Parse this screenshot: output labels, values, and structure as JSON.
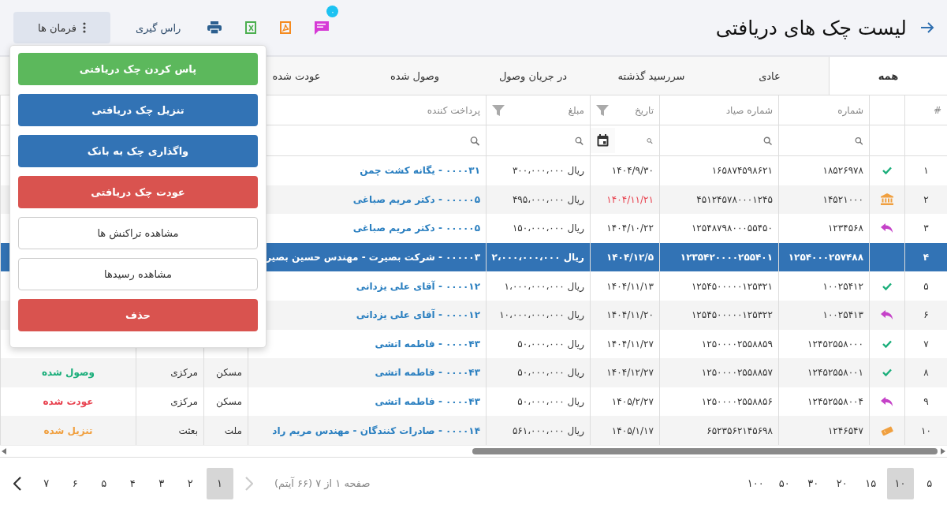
{
  "header": {
    "title": "لیست چک های دریافتی",
    "notification_badge": "۰",
    "report_button": "راس گیری",
    "commands_button": "فرمان ها"
  },
  "commands_menu": {
    "expanded": true,
    "items": [
      {
        "label": "پاس کردن چک دریافتی",
        "kind": "success"
      },
      {
        "label": "تنزیل چک دریافتی",
        "kind": "primary"
      },
      {
        "label": "واگذاری چک به بانک",
        "kind": "primary"
      },
      {
        "label": "عودت چک دریافتی",
        "kind": "danger"
      },
      {
        "label": "مشاهده تراکنش ها",
        "kind": "default"
      },
      {
        "label": "مشاهده رسیدها",
        "kind": "default"
      },
      {
        "label": "حذف",
        "kind": "danger"
      }
    ]
  },
  "tabs": [
    {
      "label": "همه",
      "selected": true
    },
    {
      "label": "عادی",
      "selected": false
    },
    {
      "label": "سررسید گذشته",
      "selected": false
    },
    {
      "label": "در جریان وصول",
      "selected": false
    },
    {
      "label": "وصول شده",
      "selected": false
    },
    {
      "label": "عودت شده",
      "selected": false
    }
  ],
  "table": {
    "columns": [
      {
        "label": "#"
      },
      {
        "label": "شماره",
        "search": true
      },
      {
        "label": "شماره صیاد",
        "search": true
      },
      {
        "label": "تاریخ",
        "search": true,
        "filter": true,
        "calendar": true
      },
      {
        "label": "مبلغ",
        "search": true,
        "filter": true
      },
      {
        "label": "پرداخت کننده",
        "search": true
      }
    ],
    "rows": [
      {
        "index": "۱",
        "kind": "check",
        "number": "۱۸۵۲۶۹۷۸",
        "sayad": "۱۶۵۸۷۴۵۹۸۶۲۱",
        "date": "۱۴۰۴/۹/۳۰",
        "overdue": false,
        "amount": "ریال ۳۰۰،۰۰۰،۰۰۰",
        "payer": "۰۰۰۰۳۱ - یگانه کشت چمن",
        "selected": false
      },
      {
        "index": "۲",
        "kind": "bank",
        "number": "۱۴۵۲۱۰۰۰",
        "sayad": "۴۵۱۲۴۵۷۸۰۰۰۱۲۴۵",
        "date": "۱۴۰۴/۱۱/۲۱",
        "overdue": true,
        "amount": "ریال ۴۹۵،۰۰۰،۰۰۰",
        "payer": "۰۰۰۰۰۵ - دکتر مریم صباغی",
        "selected": false
      },
      {
        "index": "۳",
        "kind": "reply",
        "number": "۱۲۳۴۵۶۸",
        "sayad": "۱۲۵۴۸۷۹۸۰۰۰۵۵۴۵۰",
        "date": "۱۴۰۴/۱۰/۲۲",
        "overdue": false,
        "amount": "ریال ۱۵۰،۰۰۰،۰۰۰",
        "payer": "۰۰۰۰۰۵ - دکتر مریم صباغی",
        "selected": false
      },
      {
        "index": "۴",
        "number": "۱۲۵۴۰۰۰۲۵۷۴۸۸",
        "sayad": "۱۲۳۵۴۲۰۰۰۰۲۵۵۴۰۱",
        "date": "۱۴۰۴/۱۲/۵",
        "overdue": false,
        "amount": "ریال ۲،۰۰۰،۰۰۰،۰۰۰",
        "payer": "۰۰۰۰۰۳ - شرکت بصیرت - مهندس حسین بصیر",
        "selected": true
      },
      {
        "index": "۵",
        "kind": "check",
        "number": "۱۰۰۲۵۴۱۲",
        "sayad": "۱۲۵۴۵۰۰۰۰۰۱۲۵۳۲۱",
        "date": "۱۴۰۴/۱۱/۱۳",
        "overdue": false,
        "amount": "ریال ۱،۰۰۰،۰۰۰،۰۰۰",
        "payer": "۰۰۰۰۱۲ - آقای علی یزدانی",
        "selected": false
      },
      {
        "index": "۶",
        "kind": "reply",
        "number": "۱۰۰۲۵۴۱۳",
        "sayad": "۱۲۵۴۵۰۰۰۰۰۱۲۵۳۲۲",
        "date": "۱۴۰۴/۱۱/۲۰",
        "overdue": false,
        "amount": "ریال ۱۰،۰۰۰،۰۰۰،۰۰۰",
        "payer": "۰۰۰۰۱۲ - آقای علی یزدانی",
        "selected": false
      },
      {
        "index": "۷",
        "kind": "check",
        "number": "۱۲۴۵۲۵۵۸۰۰۰",
        "sayad": "۱۲۵۰۰۰۰۲۵۵۸۸۵۹",
        "date": "۱۴۰۴/۱۱/۲۷",
        "overdue": false,
        "amount": "ریال ۵۰،۰۰۰،۰۰۰",
        "payer": "۰۰۰۰۴۳ - فاطمه اتشی",
        "selected": false
      },
      {
        "index": "۸",
        "kind": "check",
        "number": "۱۲۴۵۲۵۵۸۰۰۱",
        "sayad": "۱۲۵۰۰۰۰۲۵۵۸۸۵۷",
        "date": "۱۴۰۴/۱۲/۲۷",
        "overdue": false,
        "amount": "ریال ۵۰،۰۰۰،۰۰۰",
        "payer": "۰۰۰۰۴۳ - فاطمه اتشی",
        "bank": "مسکن",
        "branch": "مرکزی",
        "status": {
          "text": "وصول شده",
          "color": "#1aae7a"
        },
        "selected": false
      },
      {
        "index": "۹",
        "kind": "reply",
        "number": "۱۲۴۵۲۵۵۸۰۰۴",
        "sayad": "۱۲۵۰۰۰۰۲۵۵۸۸۵۶",
        "date": "۱۴۰۵/۲/۲۷",
        "overdue": false,
        "amount": "ریال ۵۰،۰۰۰،۰۰۰",
        "payer": "۰۰۰۰۴۳ - فاطمه اتشی",
        "bank": "مسکن",
        "branch": "مرکزی",
        "status": {
          "text": "عودت شده",
          "color": "#e8424f"
        },
        "selected": false
      },
      {
        "index": "۱۰",
        "kind": "note",
        "number": "۱۲۴۶۵۴۷",
        "sayad": "۶۵۲۳۵۶۲۱۴۵۶۹۸",
        "date": "۱۴۰۵/۱/۱۷",
        "overdue": false,
        "amount": "ریال ۵۶۱،۰۰۰،۰۰۰",
        "payer": "۰۰۰۰۱۴ - صادرات کنندگان - مهندس مریم راد",
        "bank": "ملت",
        "branch": "بعثت",
        "status": {
          "text": "تنزیل شده",
          "color": "#f0a040"
        },
        "selected": false
      }
    ]
  },
  "pagination": {
    "page_sizes": [
      {
        "label": "۵",
        "selected": false
      },
      {
        "label": "۱۰",
        "selected": true
      },
      {
        "label": "۱۵",
        "selected": false
      },
      {
        "label": "۲۰",
        "selected": false
      },
      {
        "label": "۳۰",
        "selected": false
      },
      {
        "label": "۵۰",
        "selected": false
      },
      {
        "label": "۱۰۰",
        "selected": false
      }
    ],
    "summary": "صفحه ۱ از ۷ (۶۶ آیتم)",
    "prev": {
      "disabled": true
    },
    "next": {
      "disabled": false
    },
    "pages": [
      {
        "label": "۱",
        "selected": true
      },
      {
        "label": "۲",
        "selected": false
      },
      {
        "label": "۳",
        "selected": false
      },
      {
        "label": "۴",
        "selected": false
      },
      {
        "label": "۵",
        "selected": false
      },
      {
        "label": "۶",
        "selected": false
      },
      {
        "label": "۷",
        "selected": false
      }
    ]
  }
}
